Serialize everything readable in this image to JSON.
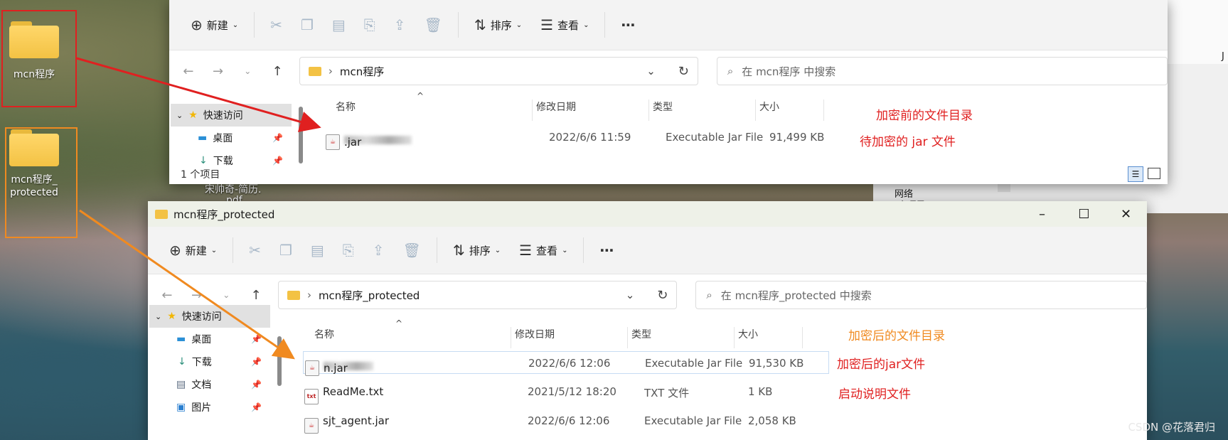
{
  "colors": {
    "red_annot": "#e02020",
    "orange_annot": "#f08a20",
    "accent": "#0067c0"
  },
  "desktop": {
    "icons": [
      {
        "label": "mcn程序"
      },
      {
        "label": "mcn程序_protected",
        "line1": "mcn程序_",
        "line2": "protected"
      }
    ],
    "partial_text": "宋帅奇-简历.",
    "partial_text2": "pdf",
    "bg_partial": "网络",
    "bg_partial2": "1 个项目",
    "bg_partial3": "J"
  },
  "toolbar": {
    "new_label": "新建",
    "sort_label": "排序",
    "view_label": "查看",
    "more_label": "⋯"
  },
  "window1": {
    "path_folder": "mcn程序",
    "search_placeholder": "在 mcn程序 中搜索",
    "sidebar": [
      {
        "label": "快速访问",
        "icon": "star-icon"
      },
      {
        "label": "桌面",
        "icon": "desktop-icon"
      },
      {
        "label": "下载",
        "icon": "download-icon"
      }
    ],
    "columns": {
      "name": "名称",
      "date": "修改日期",
      "type": "类型",
      "size": "大小"
    },
    "files": [
      {
        "name_suffix": ".jar",
        "date": "2022/6/6 11:59",
        "type": "Executable Jar File",
        "size": "91,499 KB"
      }
    ],
    "status": "1 个项目"
  },
  "window2": {
    "title": "mcn程序_protected",
    "path_folder": "mcn程序_protected",
    "search_placeholder": "在 mcn程序_protected 中搜索",
    "sidebar": [
      {
        "label": "快速访问",
        "icon": "star-icon"
      },
      {
        "label": "桌面",
        "icon": "desktop-icon"
      },
      {
        "label": "下载",
        "icon": "download-icon"
      },
      {
        "label": "文档",
        "icon": "document-icon"
      },
      {
        "label": "图片",
        "icon": "picture-icon"
      }
    ],
    "columns": {
      "name": "名称",
      "date": "修改日期",
      "type": "类型",
      "size": "大小"
    },
    "files": [
      {
        "name_suffix": "n.jar",
        "date": "2022/6/6 12:06",
        "type": "Executable Jar File",
        "size": "91,530 KB"
      },
      {
        "name": "ReadMe.txt",
        "date": "2021/5/12 18:20",
        "type": "TXT 文件",
        "size": "1 KB"
      },
      {
        "name": "sjt_agent.jar",
        "date": "2022/6/6 12:06",
        "type": "Executable Jar File",
        "size": "2,058 KB"
      }
    ]
  },
  "annotations": {
    "before_dir": "加密前的文件目录",
    "to_encrypt": "待加密的 jar 文件",
    "after_dir": "加密后的文件目录",
    "encrypted_jar": "加密后的jar文件",
    "readme": "启动说明文件"
  },
  "watermark": "CSDN @花落君归"
}
